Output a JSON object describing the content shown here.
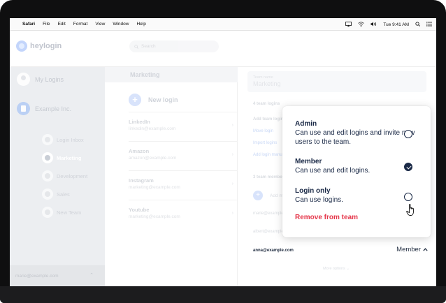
{
  "menubar": {
    "app_name": "Safari",
    "items": [
      "File",
      "Edit",
      "Format",
      "View",
      "Window",
      "Help"
    ],
    "clock": "Tue 9:41 AM"
  },
  "app": {
    "logo_text": "heylogin",
    "search_placeholder": "Search",
    "accent_color": "#2a6cf2",
    "danger_color": "#e5374b"
  },
  "sidebar": {
    "my_logins": "My Logins",
    "company": "Example Inc.",
    "teams": [
      {
        "label": "Login Inbox",
        "active": false
      },
      {
        "label": "Marketing",
        "active": true
      },
      {
        "label": "Development",
        "active": false
      },
      {
        "label": "Sales",
        "active": false
      },
      {
        "label": "New Team",
        "active": false
      }
    ],
    "footer_email": "marie@example.com"
  },
  "middle": {
    "header": "Marketing",
    "new_login": "New login",
    "logins": [
      {
        "name": "LinkedIn",
        "email": "linkedin@example.com"
      },
      {
        "name": "Amazon",
        "email": "amazon@example.com"
      },
      {
        "name": "Instagram",
        "email": "marketing@example.com"
      },
      {
        "name": "Youtube",
        "email": "marketing@example.com"
      }
    ]
  },
  "right": {
    "team_name_label": "Team name",
    "team_name_value": "Marketing",
    "team_logins_count": "4 team logins",
    "add_team_login": "Add team login",
    "move_login": "Move login",
    "import_logins": "Import logins",
    "add_login_manually": "Add login manually",
    "team_members_count": "3 team members",
    "add_member": "Add member",
    "members": [
      {
        "email": "marie@example.com"
      },
      {
        "email": "albert@example.com"
      },
      {
        "email": "anna@example.com"
      }
    ],
    "selected_member_role": "Member",
    "more_options": "More options"
  },
  "role_popover": {
    "options": [
      {
        "title": "Admin",
        "description": "Can use and edit logins and invite new users to the team.",
        "selected": false
      },
      {
        "title": "Member",
        "description": "Can use and edit logins.",
        "selected": true
      },
      {
        "title": "Login only",
        "description": "Can use logins.",
        "selected": false
      }
    ],
    "remove_label": "Remove from team"
  }
}
